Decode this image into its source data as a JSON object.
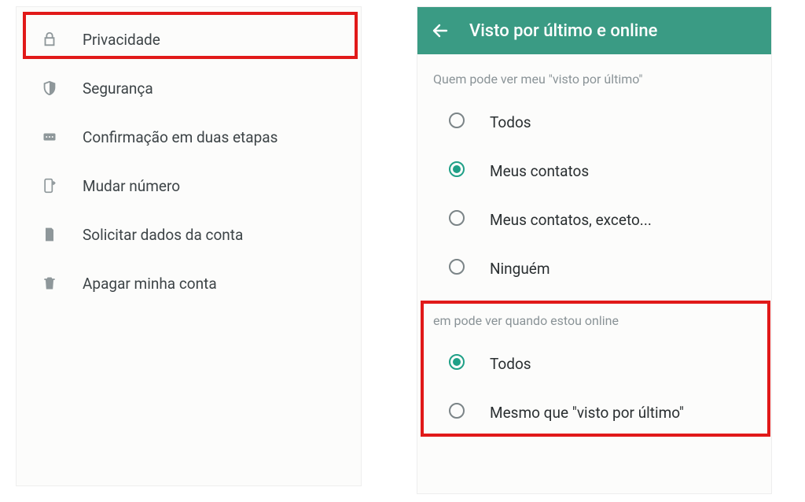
{
  "left_panel": {
    "items": [
      {
        "icon": "lock",
        "label": "Privacidade"
      },
      {
        "icon": "shield",
        "label": "Segurança"
      },
      {
        "icon": "dots-rect",
        "label": "Confirmação em duas etapas"
      },
      {
        "icon": "phone-change",
        "label": "Mudar número"
      },
      {
        "icon": "document",
        "label": "Solicitar dados da conta"
      },
      {
        "icon": "trash",
        "label": "Apagar minha conta"
      }
    ],
    "highlighted_index": 0
  },
  "right_panel": {
    "appbar_title": "Visto por último e online",
    "section1": {
      "title": "Quem pode ver meu \"visto por último\"",
      "options": [
        {
          "label": "Todos",
          "selected": false
        },
        {
          "label": "Meus contatos",
          "selected": true
        },
        {
          "label": "Meus contatos, exceto...",
          "selected": false
        },
        {
          "label": "Ninguém",
          "selected": false
        }
      ]
    },
    "section2": {
      "title": "em pode ver quando estou online",
      "options": [
        {
          "label": "Todos",
          "selected": true
        },
        {
          "label": "Mesmo que \"visto por último\"",
          "selected": false
        }
      ],
      "highlighted": true
    }
  },
  "colors": {
    "accent": "#3a9b84",
    "radio_selected": "#1fa087",
    "highlight_border": "#e11919"
  }
}
